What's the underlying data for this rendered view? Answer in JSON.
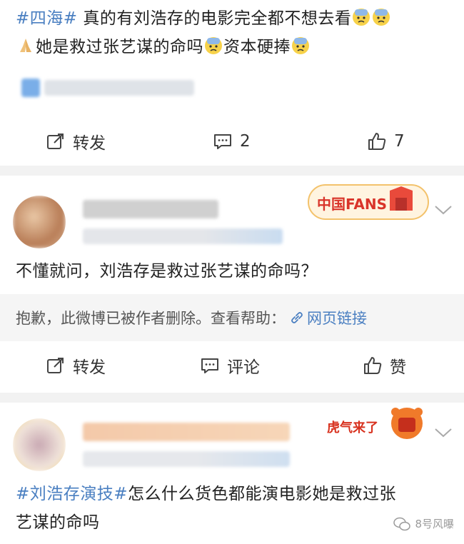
{
  "post1": {
    "tag": "#四海#",
    "text_a": " 真的有刘浩存的电影完全都不想去看",
    "text_b": "她是救过张艺谋的命吗",
    "text_c": "资本硬捧"
  },
  "post1_actions": {
    "repost_label": "转发",
    "comment_count": "2",
    "like_count": "7"
  },
  "post2": {
    "text": "不懂就问，刘浩存是救过张艺谋的命吗？",
    "deleted_notice": "抱歉，此微博已被作者删除。查看帮助：",
    "web_link": "网页链接",
    "badge_text": "中国FANS"
  },
  "post2_actions": {
    "repost_label": "转发",
    "comment_label": "评论",
    "like_label": "赞"
  },
  "post3": {
    "tag": "#刘浩存演技#",
    "text_line1": "怎么什么货色都能演电影她是救过张",
    "text_line2": "艺谋的命吗",
    "badge_text": "虎气来了"
  },
  "watermark": {
    "text": "8号风曝"
  },
  "colors": {
    "link_blue": "#4a7fc1",
    "separator": "#f2f2f2",
    "deleted_bg": "#f5f5f5"
  }
}
